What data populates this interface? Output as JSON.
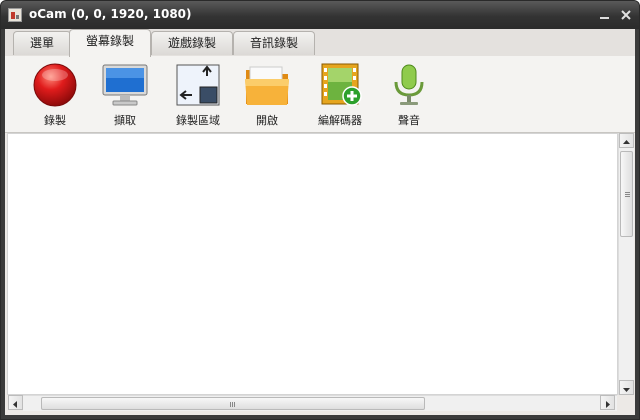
{
  "window": {
    "title": "oCam (0, 0, 1920, 1080)"
  },
  "tabs": [
    {
      "label": "選單",
      "active": false
    },
    {
      "label": "螢幕錄製",
      "active": true
    },
    {
      "label": "遊戲錄製",
      "active": false
    },
    {
      "label": "音訊錄製",
      "active": false
    }
  ],
  "toolbar": {
    "record": "錄製",
    "capture": "擷取",
    "record_area": "錄製區域",
    "open": "開啟",
    "codec": "編解碼器",
    "sound": "聲音"
  },
  "colors": {
    "titlebar": "#2b2b2b",
    "record": "#d11a1a",
    "folder": "#f5a623",
    "codec_plus": "#2ca02c",
    "mic": "#7fbf3f"
  }
}
